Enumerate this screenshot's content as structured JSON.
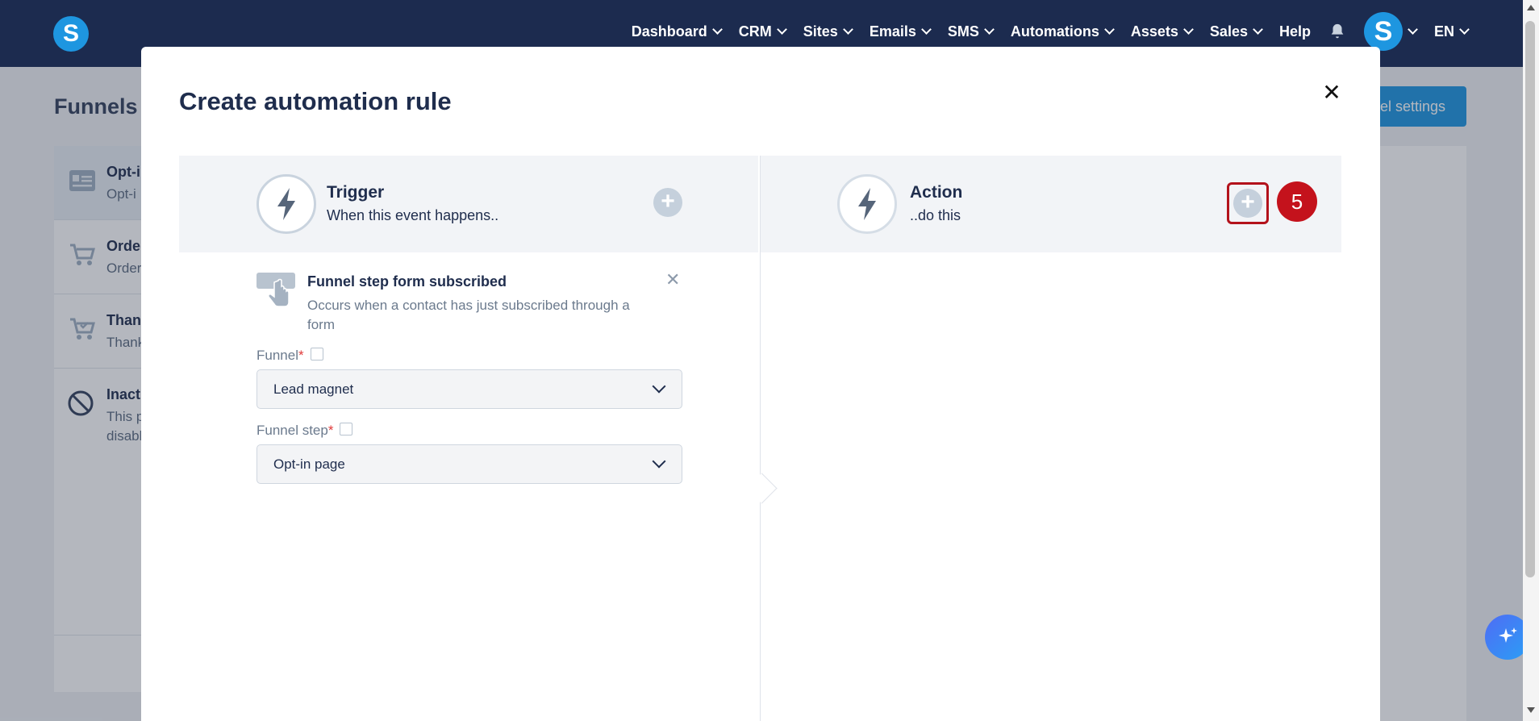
{
  "nav": {
    "logo_letter": "S",
    "items": [
      {
        "label": "Dashboard"
      },
      {
        "label": "CRM"
      },
      {
        "label": "Sites"
      },
      {
        "label": "Emails"
      },
      {
        "label": "SMS"
      },
      {
        "label": "Automations"
      },
      {
        "label": "Assets"
      },
      {
        "label": "Sales"
      }
    ],
    "help_label": "Help",
    "avatar_letter": "S",
    "language": "EN"
  },
  "page": {
    "title": "Funnels",
    "settings_button": "nel settings",
    "steps": [
      {
        "title": "Opt-i",
        "subtitle": "Opt-i",
        "icon": "form-icon"
      },
      {
        "title": "Orde",
        "subtitle": "Order",
        "icon": "cart-icon"
      },
      {
        "title": "Than",
        "subtitle": "Thank",
        "icon": "cart-check-icon"
      }
    ],
    "inactive": {
      "title": "Inact",
      "line1": "This p",
      "line2": "disabl"
    }
  },
  "modal": {
    "title": "Create automation rule",
    "trigger": {
      "title": "Trigger",
      "subtitle": "When this event happens.."
    },
    "action": {
      "title": "Action",
      "subtitle": "..do this"
    },
    "step_badge": "5",
    "event": {
      "title": "Funnel step form subscribed",
      "description": "Occurs when a contact has just subscribed through a form"
    },
    "funnel_field": {
      "label": "Funnel",
      "value": "Lead magnet"
    },
    "funnel_step_field": {
      "label": "Funnel step",
      "value": "Opt-in page"
    }
  },
  "colors": {
    "nav_bg": "#1c2b4f",
    "brand_blue": "#1e96e0",
    "highlight_red": "#c4121c"
  }
}
